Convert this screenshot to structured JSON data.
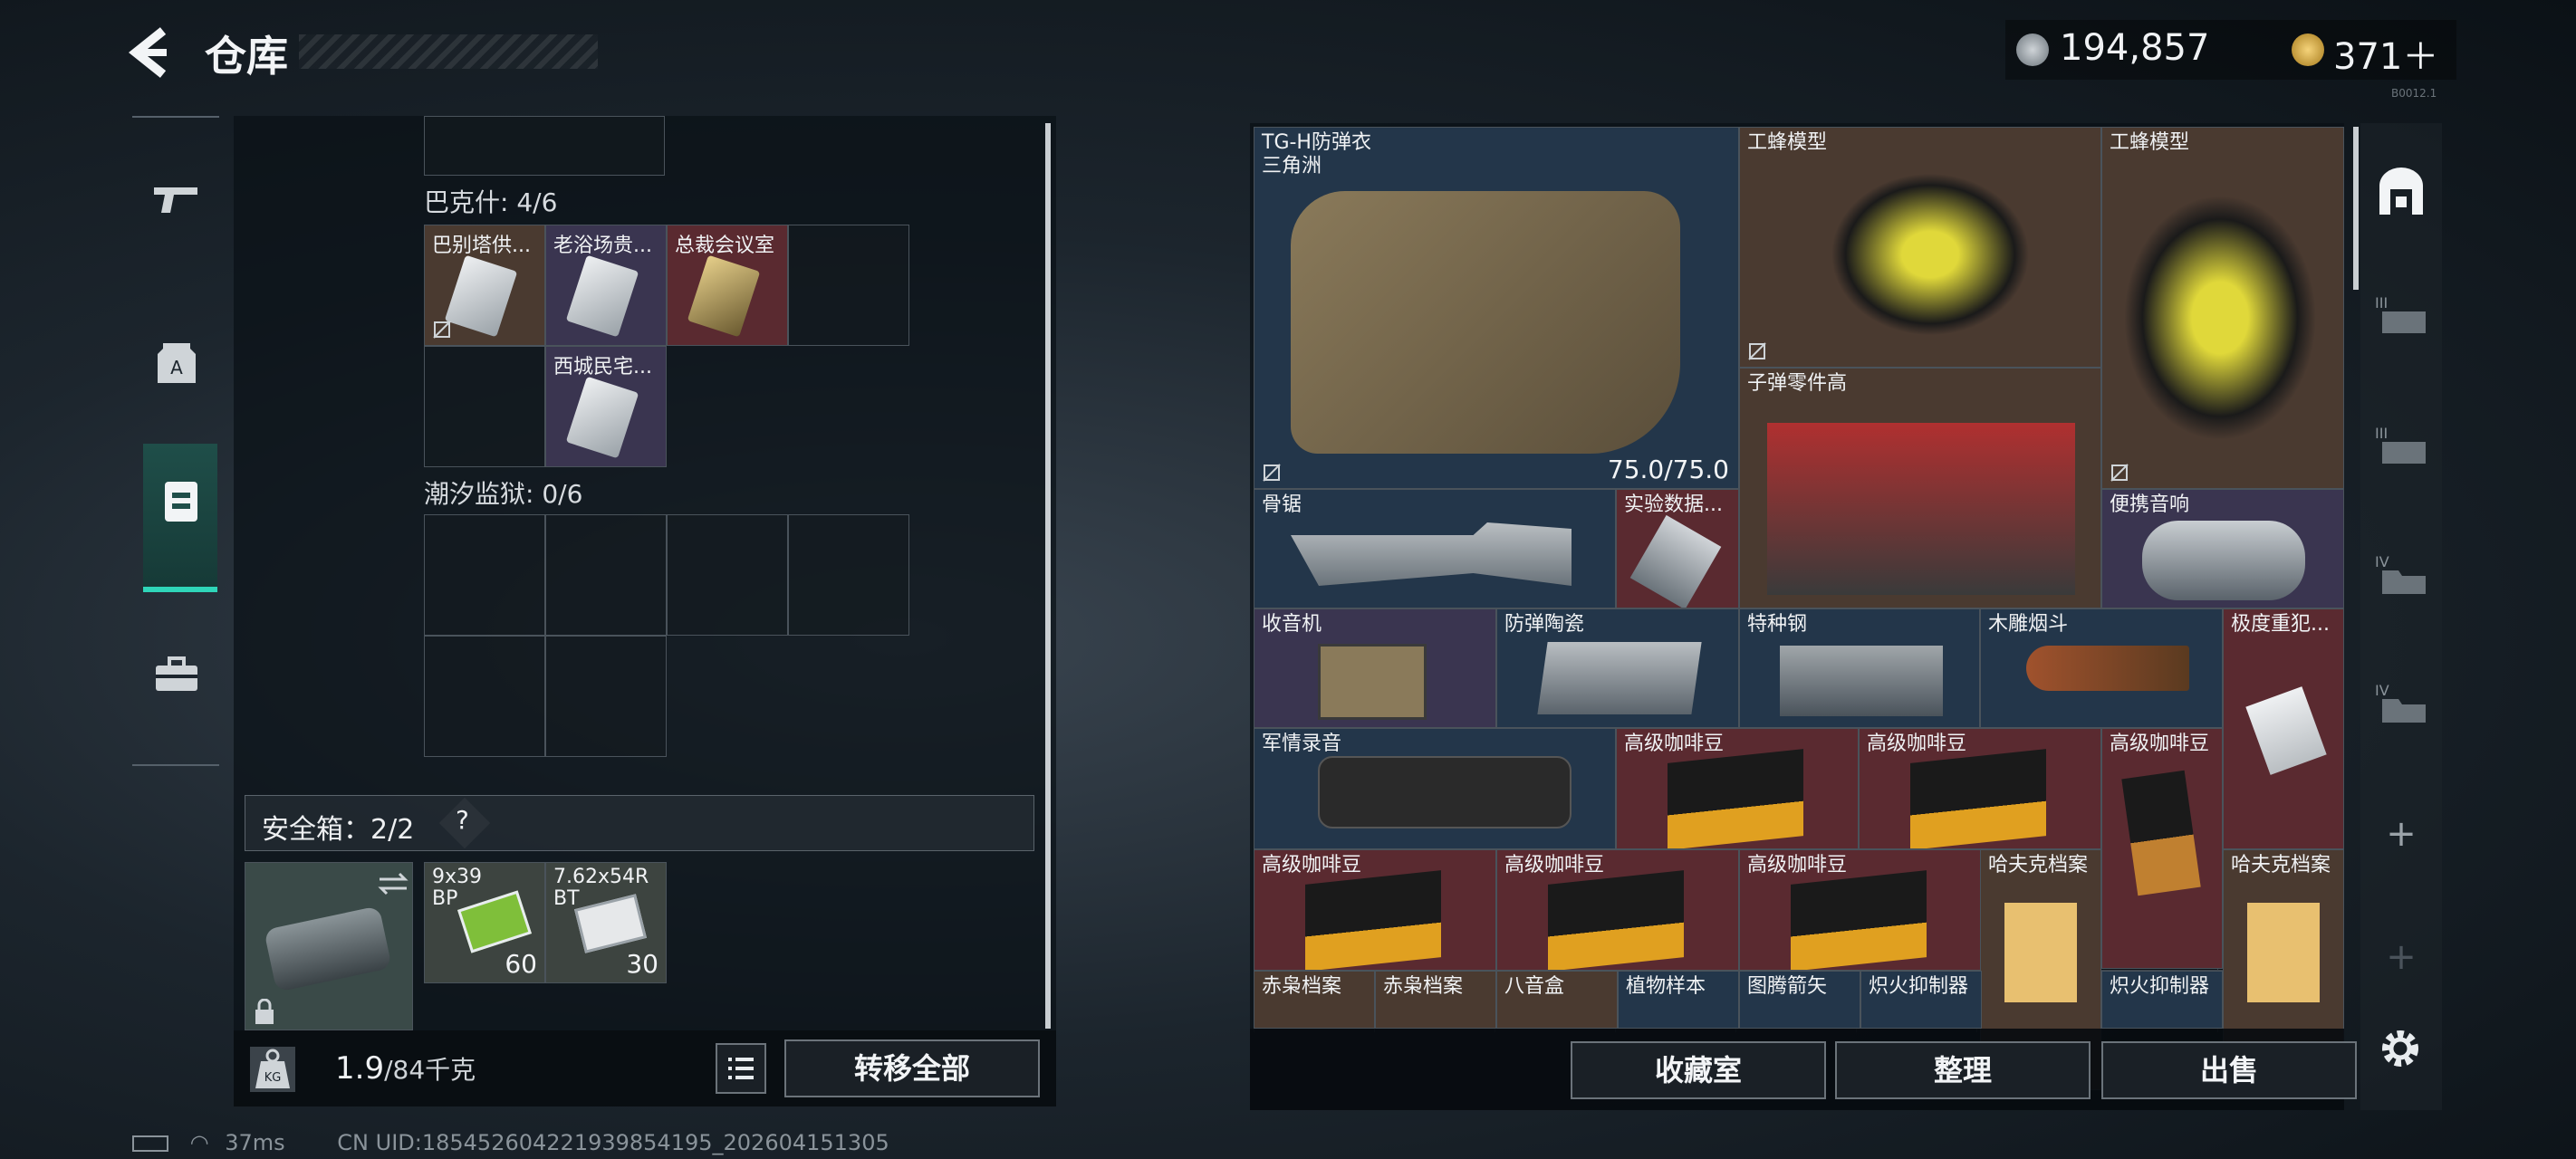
{
  "header": {
    "title": "仓库",
    "currency_1": "194,857",
    "currency_2": "371＋",
    "version": "B0012.1"
  },
  "left_nav": {
    "items": [
      "weapons",
      "armor",
      "backpack",
      "briefcase"
    ],
    "active": "backpack"
  },
  "left_panel": {
    "sections": [
      {
        "title": "巴克什: 4/6",
        "items": [
          "巴别塔供...",
          "老浴场贵...",
          "总裁会议室",
          "西城民宅..."
        ]
      },
      {
        "title": "潮汐监狱: 0/6",
        "items": []
      }
    ],
    "safe_box": {
      "label": "安全箱：2/2",
      "help": "?"
    },
    "ammo": [
      {
        "name": "9x39 BP",
        "count": "60"
      },
      {
        "name": "7.62x54R BT",
        "count": "30"
      }
    ]
  },
  "weight": {
    "value": "1.9",
    "unit": "/84千克"
  },
  "transfer_all": "转移全部",
  "stash": {
    "items": [
      {
        "name": "TG-H防弹衣",
        "sub": "三角洲",
        "durability": "75.0/75.0"
      },
      {
        "name": "工蜂模型"
      },
      {
        "name": "工蜂模型"
      },
      {
        "name": "子弹零件高"
      },
      {
        "name": "骨锯"
      },
      {
        "name": "实验数据..."
      },
      {
        "name": "便携音响"
      },
      {
        "name": "收音机"
      },
      {
        "name": "防弹陶瓷"
      },
      {
        "name": "特种钢"
      },
      {
        "name": "木雕烟斗"
      },
      {
        "name": "极度重犯..."
      },
      {
        "name": "军情录音"
      },
      {
        "name": "高级咖啡豆"
      },
      {
        "name": "高级咖啡豆"
      },
      {
        "name": "高级咖啡豆"
      },
      {
        "name": "高级咖啡豆"
      },
      {
        "name": "高级咖啡豆"
      },
      {
        "name": "高级咖啡豆"
      },
      {
        "name": "哈夫克档案"
      },
      {
        "name": "哈夫克档案"
      },
      {
        "name": "赤枭档案"
      },
      {
        "name": "赤枭档案"
      },
      {
        "name": "八音盒"
      },
      {
        "name": "植物样本"
      },
      {
        "name": "图腾箭矢"
      },
      {
        "name": "炽火抑制器"
      },
      {
        "name": "炽火抑制器"
      }
    ]
  },
  "actions": {
    "collection": "收藏室",
    "sort": "整理",
    "sell": "出售"
  },
  "right_tabs": [
    "storage-all",
    "tier-III-shelf-1",
    "tier-III-shelf-2",
    "tier-IV-shelf-1",
    "tier-IV-shelf-2",
    "add",
    "add-disabled",
    "settings"
  ],
  "right_tab_labels": {
    "t1": "III",
    "t2": "III",
    "t3": "IV",
    "t4": "IV",
    "add": "+"
  },
  "status": {
    "ping": "37ms",
    "uid": "CN UID:185452604221939854195_202604151305"
  },
  "colors": {
    "accent": "#2fd6b9",
    "red_cell": "#5a2a30",
    "brown_cell": "#4a3a30",
    "blue_cell": "#23364a",
    "purple_cell": "#3a3550"
  }
}
